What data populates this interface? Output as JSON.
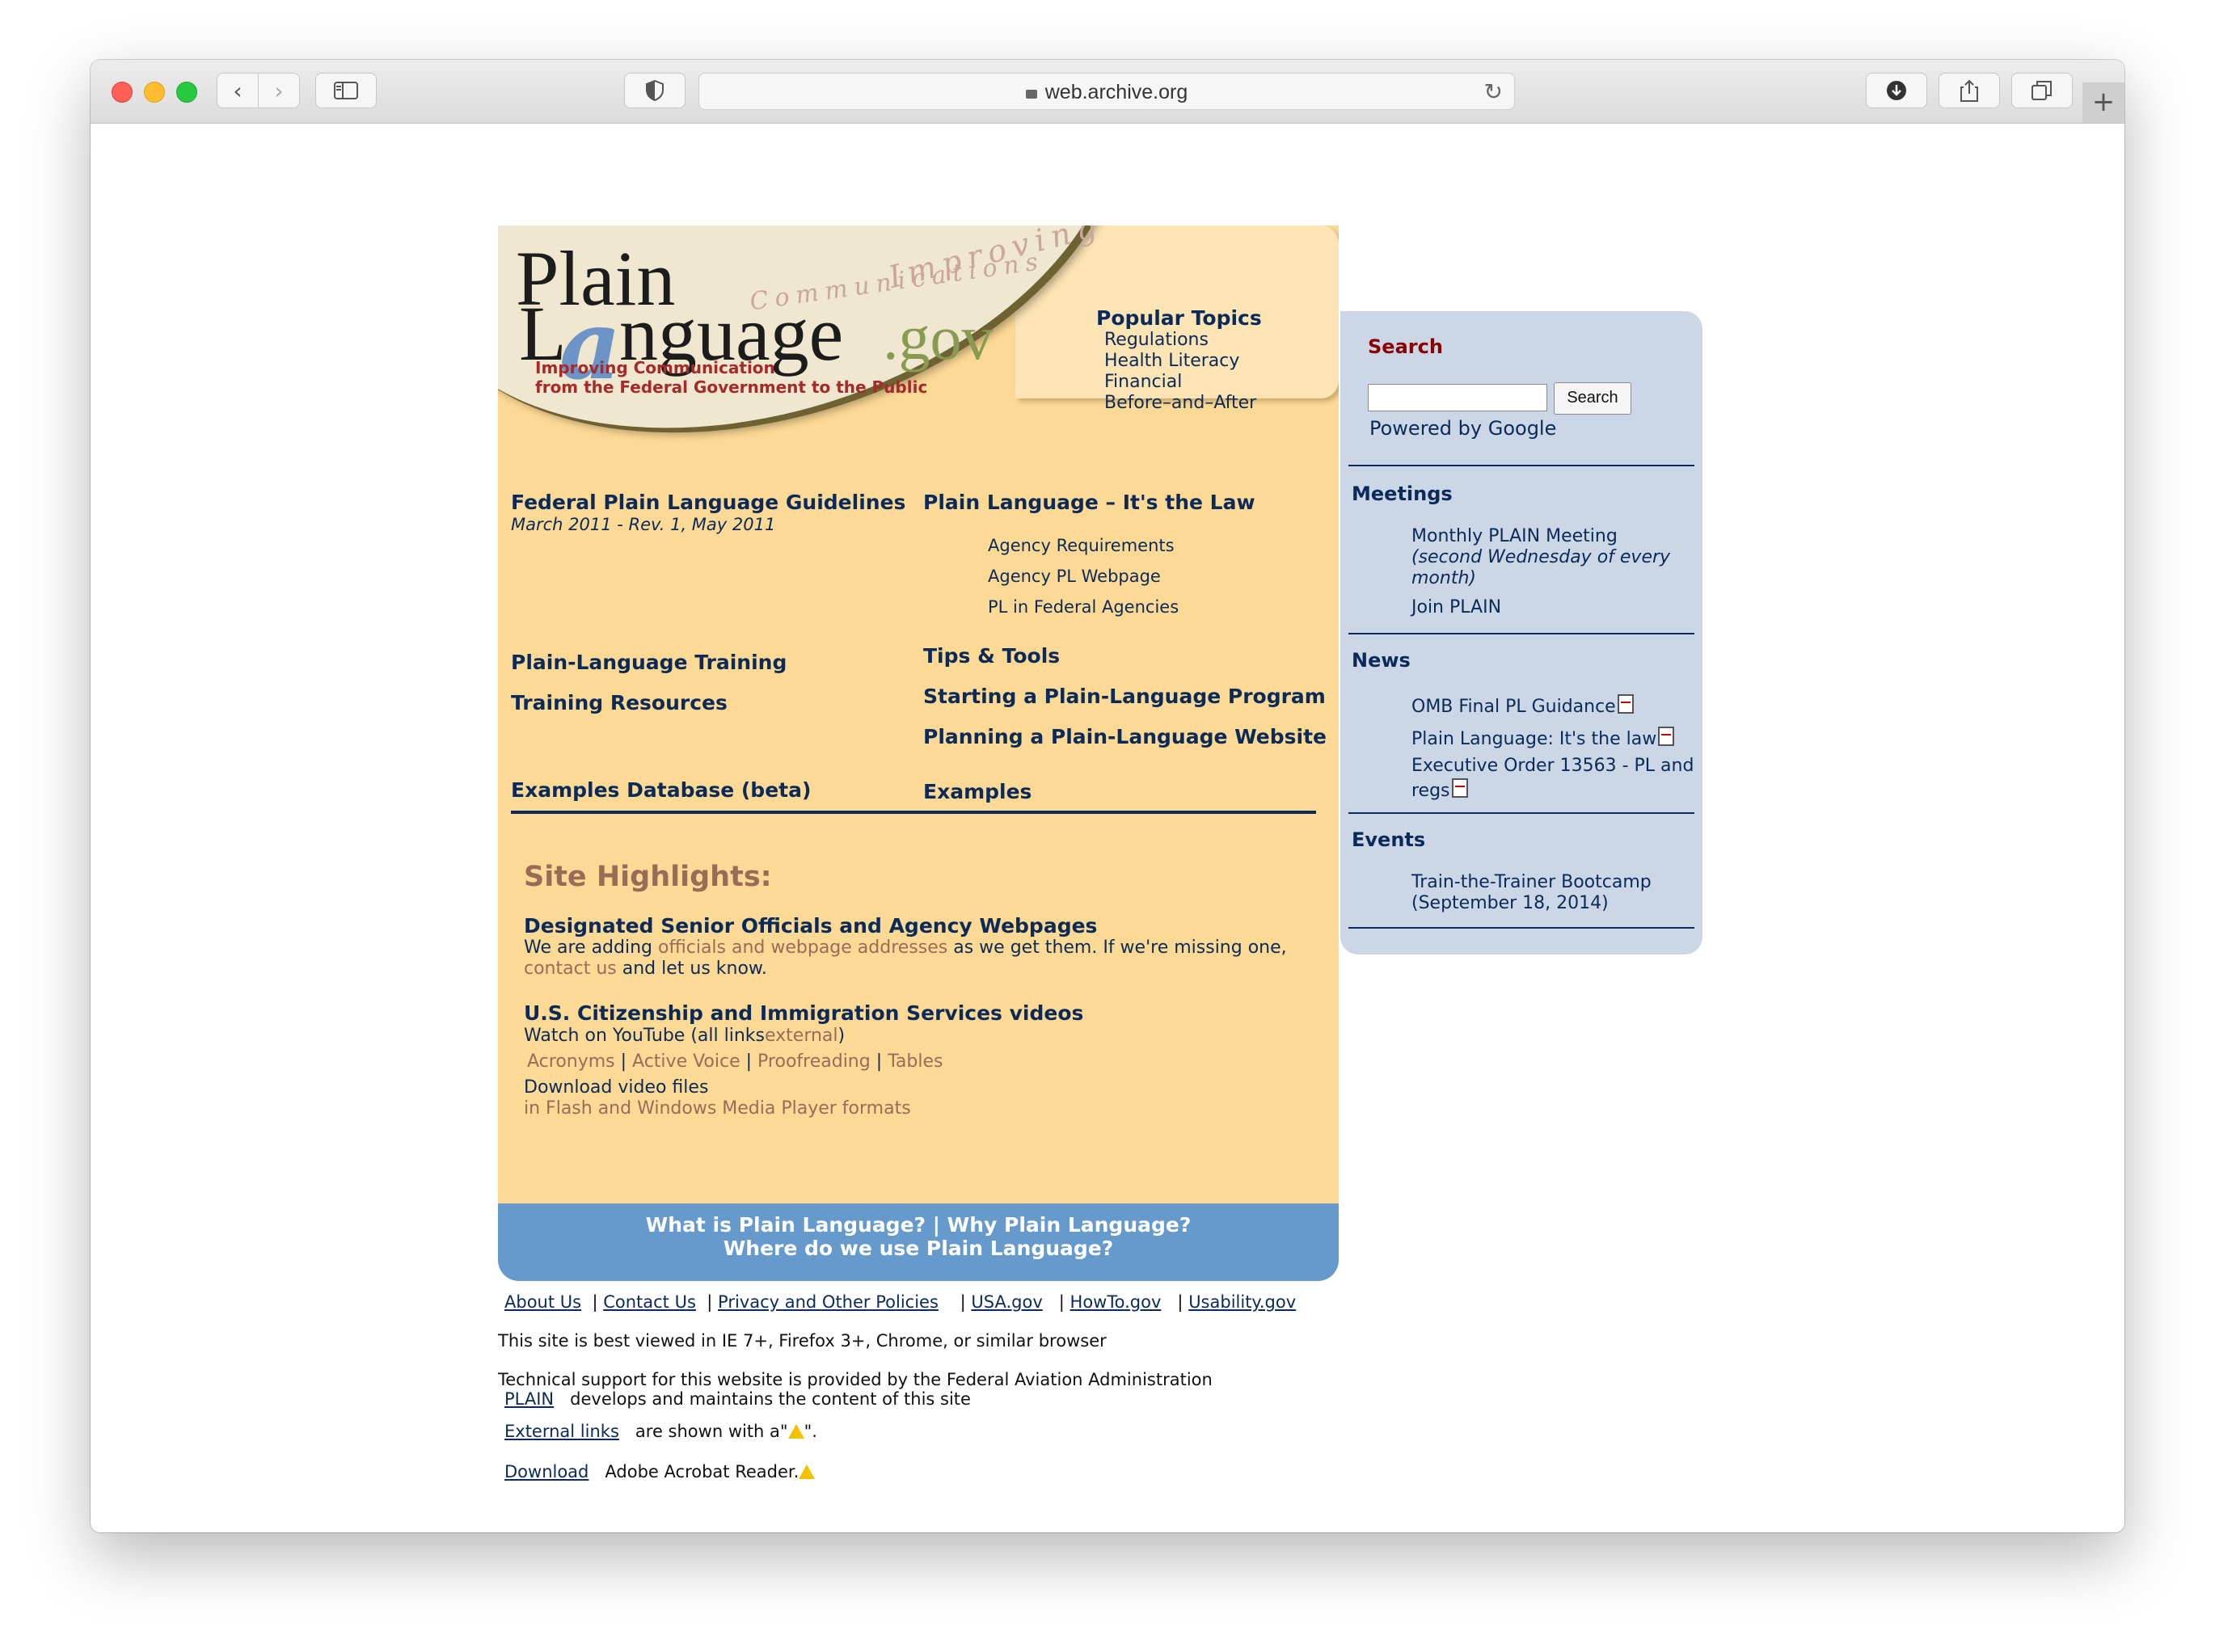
{
  "browser": {
    "url": "web.archive.org"
  },
  "logo": {
    "word1": "Plain",
    "word2_prefix": "L",
    "word2_a": "a",
    "word2_suffix": "nguage",
    "gov": ".gov",
    "script1": "Improving",
    "script2": "Communications",
    "tagline1": "Improving Communication",
    "tagline2": "from the Federal Government to the Public"
  },
  "popular": {
    "heading": "Popular Topics",
    "items": [
      "Regulations",
      "Health Literacy",
      "Financial",
      "Before–and–After"
    ]
  },
  "main": {
    "guidelines": "Federal Plain Language Guidelines",
    "guidelines_date": "March 2011 - Rev. 1, May 2011",
    "law": "Plain Language – It's the Law",
    "law_items": [
      "Agency Requirements",
      "Agency PL Webpage",
      "PL in Federal Agencies"
    ],
    "training": "Plain-Language Training",
    "training_resources": "Training Resources",
    "tips": "Tips & Tools",
    "starting": "Starting a Plain-Language Program",
    "planning": "Planning a Plain-Language Website",
    "examples_db": "Examples Database (beta)",
    "examples": "Examples"
  },
  "highlights": {
    "title": "Site Highlights:",
    "h1": "Designated Senior Officials and Agency Webpages",
    "p1_a": "We are adding",
    "p1_link": "officials and webpage addresses",
    "p1_b": "as we get them. If we're missing one,",
    "p1_contact": "contact us",
    "p1_c": "and let us know.",
    "h2": "U.S. Citizenship and Immigration Services videos",
    "p2_a": "Watch on YouTube (all links",
    "p2_ext": "external",
    "p2_b": ")",
    "videos": [
      "Acronyms",
      "Active Voice",
      "Proofreading",
      "Tables"
    ],
    "download": "Download video files",
    "formats": "in Flash and Windows Media Player formats"
  },
  "band": {
    "what": "What is Plain Language?",
    "sep": "|",
    "why": "Why Plain Language?",
    "where": "Where do we use Plain Language?"
  },
  "sidebar": {
    "search_heading": "Search",
    "search_button": "Search",
    "powered": "Powered by Google",
    "meetings_heading": "Meetings",
    "meeting1": "Monthly PLAIN Meeting",
    "meeting1_note": "(second Wednesday of every month)",
    "join": "Join PLAIN",
    "news_heading": "News",
    "news": [
      "OMB Final PL Guidance",
      "Plain Language: It's the law",
      "Executive Order 13563 - PL and regs"
    ],
    "events_heading": "Events",
    "event1": "Train-the-Trainer Bootcamp",
    "event1_date": "(September 18, 2014)"
  },
  "footer": {
    "links": [
      "About Us",
      "Contact Us",
      "Privacy and Other Policies",
      "USA.gov",
      "HowTo.gov",
      "Usability.gov"
    ],
    "sep": "|",
    "browser_note": "This site is best viewed in IE 7+, Firefox 3+, Chrome, or similar browser",
    "tech_support": "Technical support for this website is provided by the Federal Aviation Administration",
    "plain": "PLAIN",
    "plain_text": "develops and maintains the content of this site",
    "external_links": "External links",
    "external_text_a": "are shown with a\"",
    "external_text_b": "\".",
    "download": "Download",
    "acrobat": "Adobe Acrobat Reader."
  }
}
